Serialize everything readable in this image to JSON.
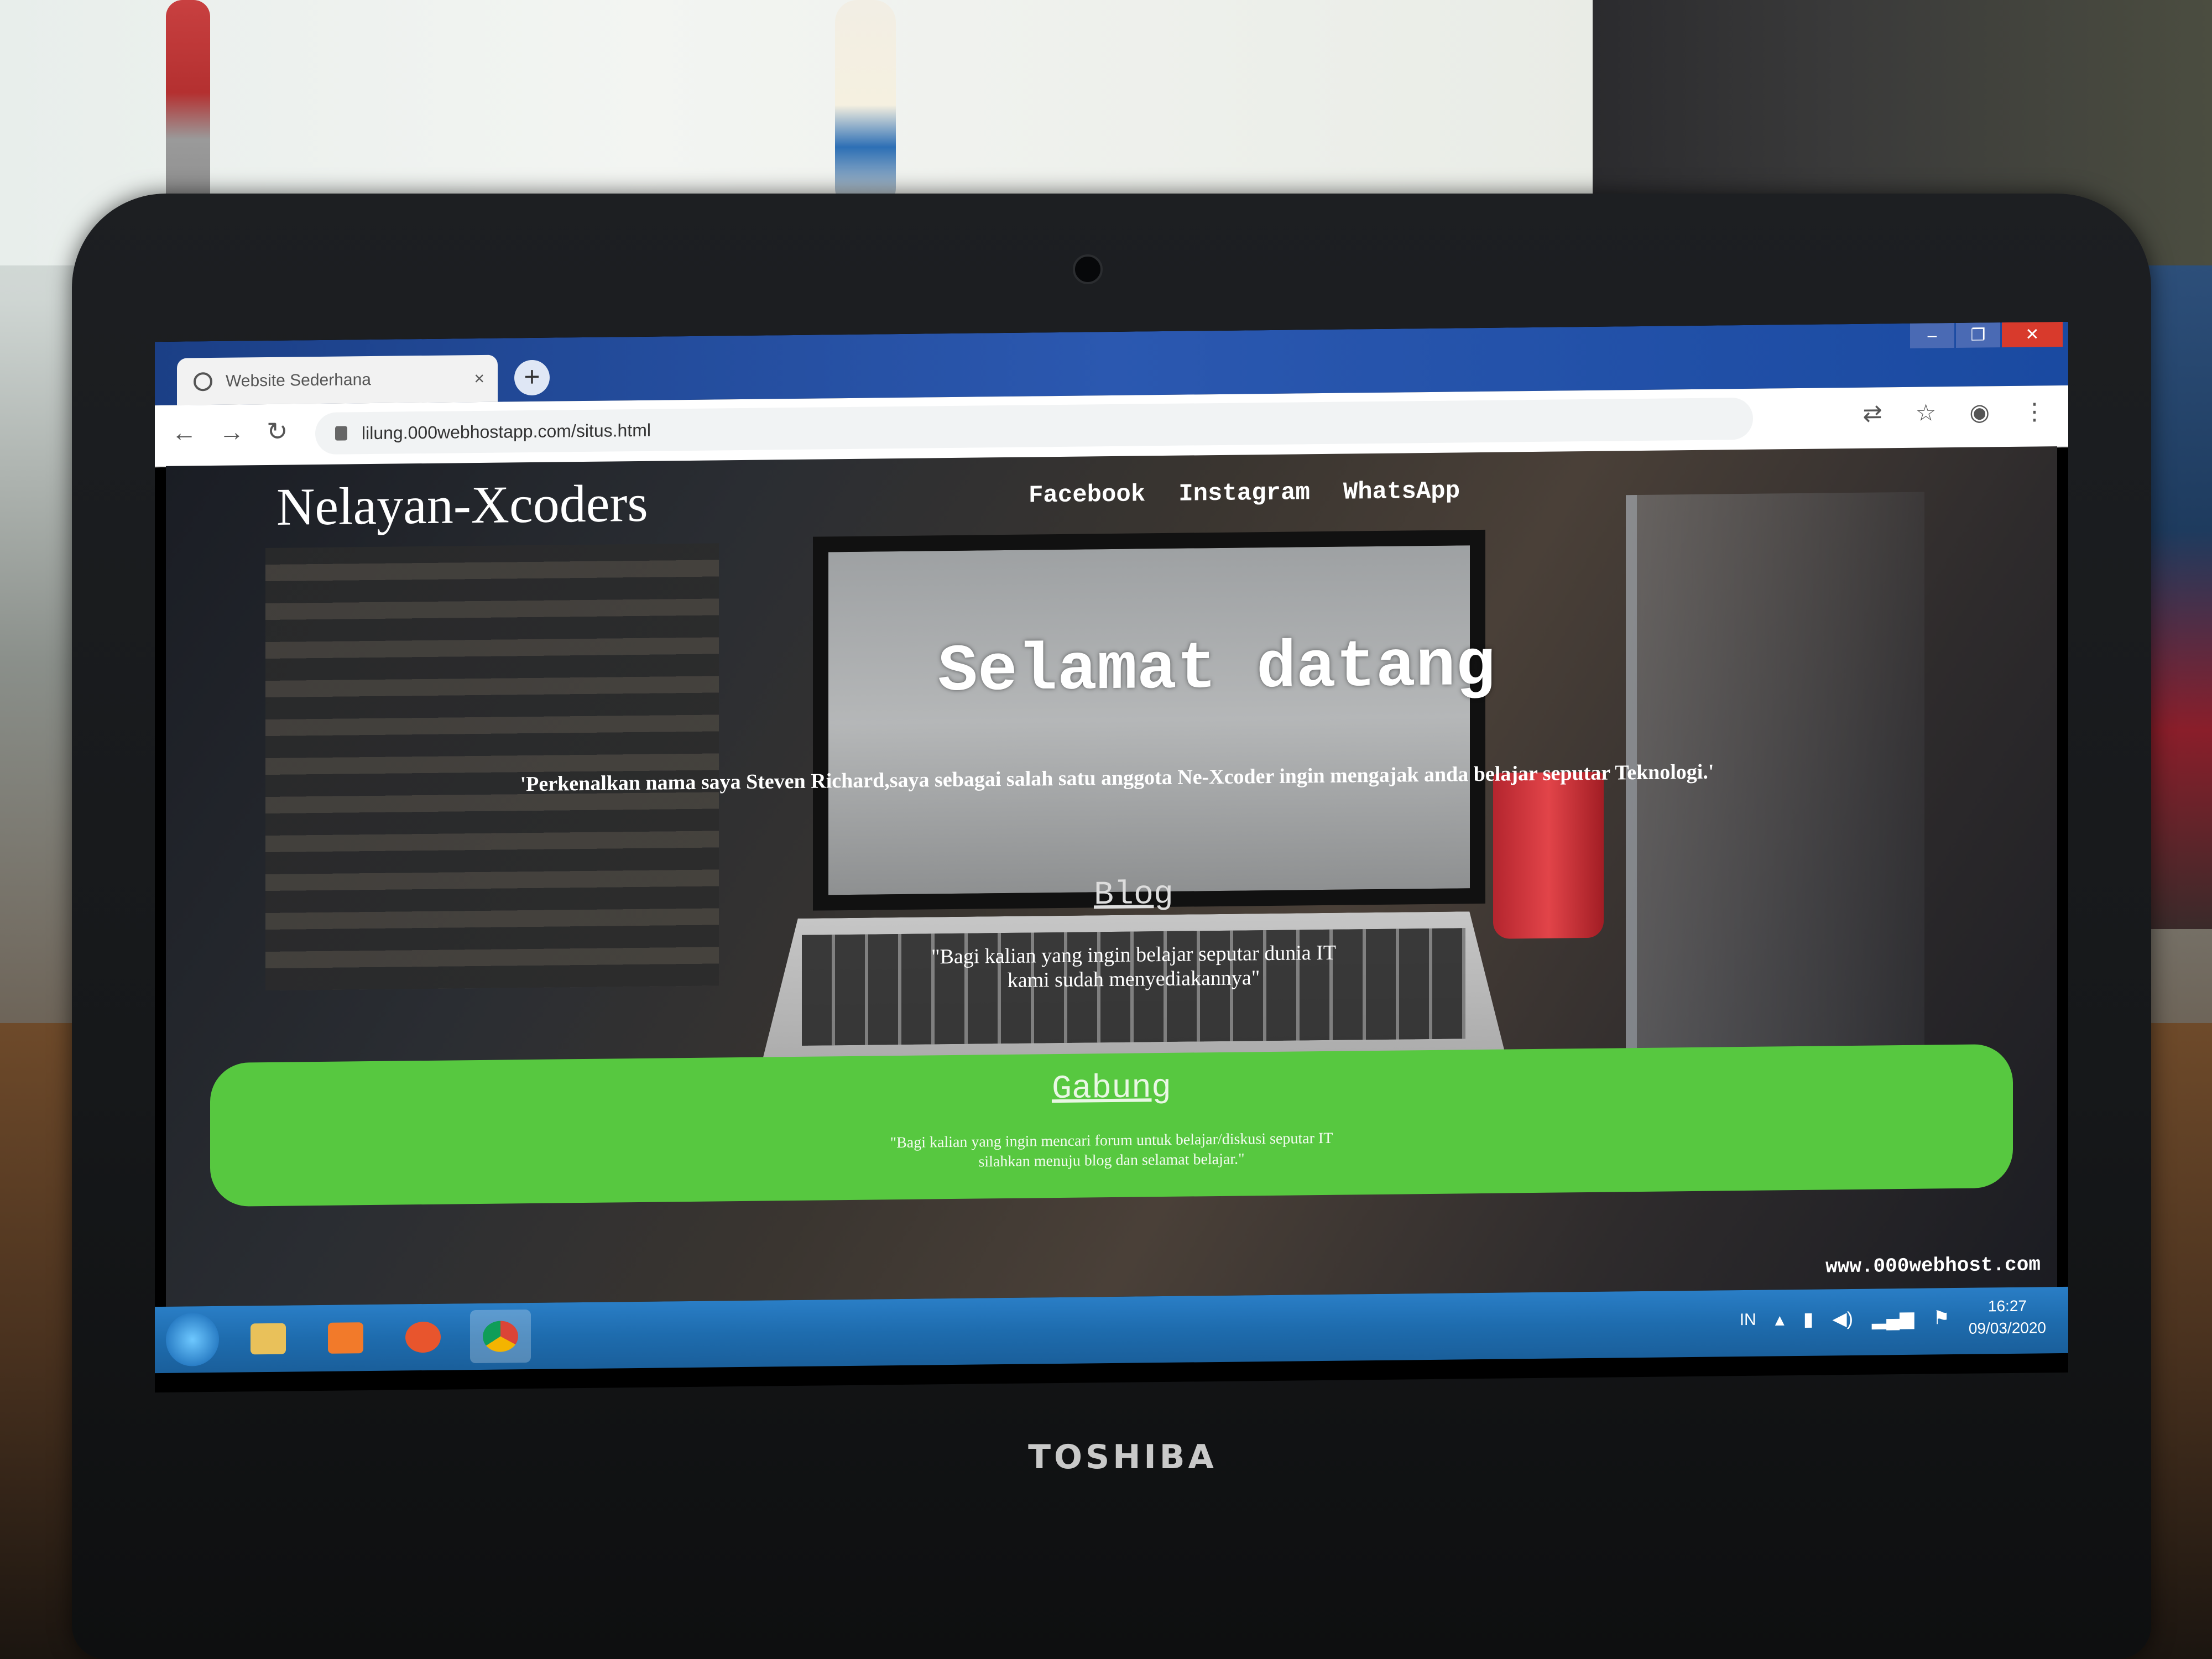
{
  "browser": {
    "tab_title": "Website Sederhana",
    "tab_close": "×",
    "new_tab": "+",
    "url": "lilung.000webhostapp.com/situs.html",
    "window_buttons": [
      "–",
      "❐",
      "✕"
    ],
    "nav_icons": [
      "back-icon",
      "forward-icon",
      "reload-icon"
    ],
    "toolbar_icons": [
      "translate-icon",
      "star-icon",
      "profile-icon",
      "menu-icon"
    ]
  },
  "site": {
    "logo": "Nelayan-Xcoders",
    "nav": [
      "Facebook",
      "Instagram",
      "WhatsApp"
    ],
    "hero_title": "Selamat datang",
    "hero_subtitle": "'Perkenalkan nama saya Steven Richard,saya sebagai salah satu anggota Ne-Xcoder ingin mengajak anda belajar seputar Teknologi.'",
    "blog_link": "Blog",
    "blog_desc_line1": "\"Bagi kalian yang ingin belajar seputar dunia IT",
    "blog_desc_line2": "kami sudah menyediakannya\"",
    "join_link": "Gabung",
    "join_desc_line1": "\"Bagi kalian yang ingin mencari forum untuk belajar/diskusi seputar IT",
    "join_desc_line2": "silahkan menuju blog dan selamat belajar.\"",
    "host_badge": "www.000webhost.com",
    "join_band_color": "#57c840"
  },
  "taskbar": {
    "apps": [
      "explorer-icon",
      "media-player-icon",
      "firefox-icon",
      "chrome-icon"
    ],
    "language": "IN",
    "time": "16:27",
    "date": "09/03/2020"
  },
  "device": {
    "brand": "TOSHIBA"
  }
}
